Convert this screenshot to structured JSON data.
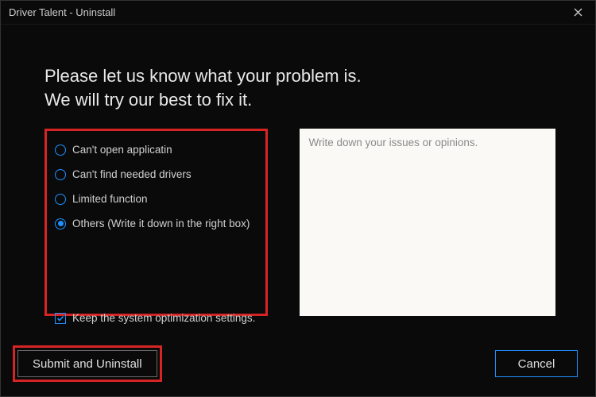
{
  "titlebar": {
    "title": "Driver Talent - Uninstall"
  },
  "heading": {
    "line1": "Please let us know what your problem is.",
    "line2": "We will try our best to fix it."
  },
  "options": [
    {
      "label": "Can't open applicatin",
      "selected": false
    },
    {
      "label": "Can't find needed drivers",
      "selected": false
    },
    {
      "label": "Limited function",
      "selected": false
    },
    {
      "label": "Others (Write it down in the right box)",
      "selected": true
    }
  ],
  "feedback": {
    "placeholder": "Write down your issues or opinions.",
    "value": ""
  },
  "checkbox": {
    "label": "Keep the system optimization settings.",
    "checked": true
  },
  "buttons": {
    "submit": "Submit and Uninstall",
    "cancel": "Cancel"
  }
}
